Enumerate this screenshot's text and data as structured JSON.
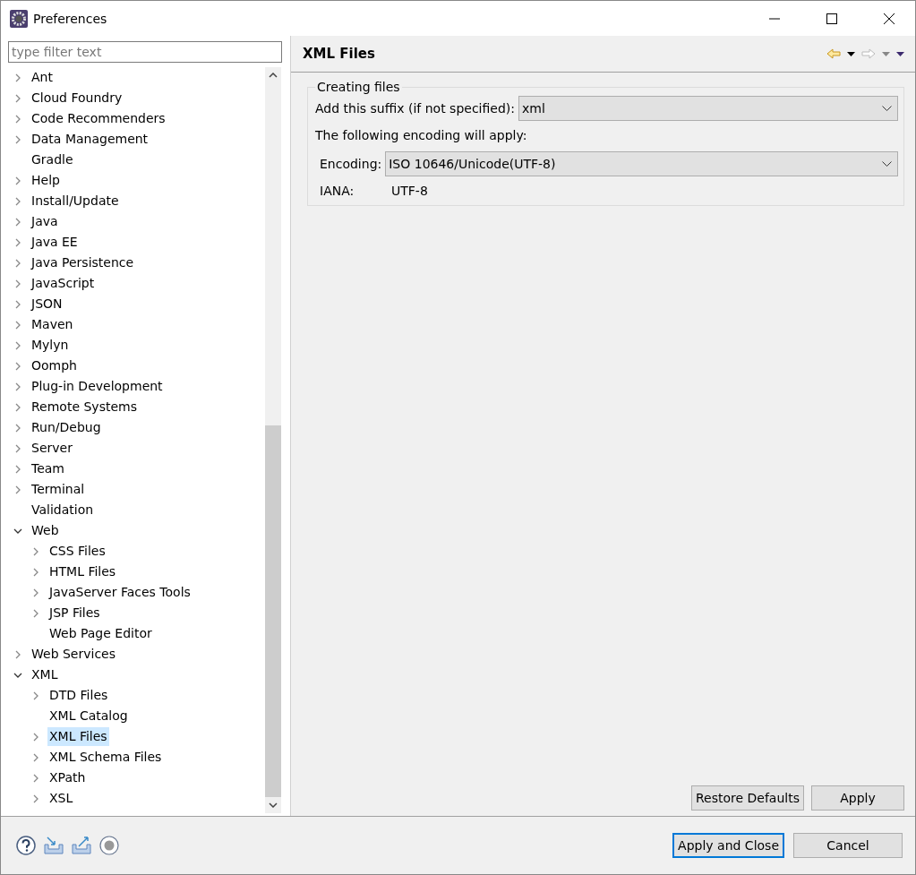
{
  "window": {
    "title": "Preferences"
  },
  "filter": {
    "placeholder": "type filter text"
  },
  "tree": [
    {
      "label": "Ant",
      "expandable": true,
      "expanded": false,
      "selected": false
    },
    {
      "label": "Cloud Foundry",
      "expandable": true,
      "expanded": false,
      "selected": false
    },
    {
      "label": "Code Recommenders",
      "expandable": true,
      "expanded": false,
      "selected": false
    },
    {
      "label": "Data Management",
      "expandable": true,
      "expanded": false,
      "selected": false
    },
    {
      "label": "Gradle",
      "expandable": false,
      "selected": false
    },
    {
      "label": "Help",
      "expandable": true,
      "expanded": false,
      "selected": false
    },
    {
      "label": "Install/Update",
      "expandable": true,
      "expanded": false,
      "selected": false
    },
    {
      "label": "Java",
      "expandable": true,
      "expanded": false,
      "selected": false
    },
    {
      "label": "Java EE",
      "expandable": true,
      "expanded": false,
      "selected": false
    },
    {
      "label": "Java Persistence",
      "expandable": true,
      "expanded": false,
      "selected": false
    },
    {
      "label": "JavaScript",
      "expandable": true,
      "expanded": false,
      "selected": false
    },
    {
      "label": "JSON",
      "expandable": true,
      "expanded": false,
      "selected": false
    },
    {
      "label": "Maven",
      "expandable": true,
      "expanded": false,
      "selected": false
    },
    {
      "label": "Mylyn",
      "expandable": true,
      "expanded": false,
      "selected": false
    },
    {
      "label": "Oomph",
      "expandable": true,
      "expanded": false,
      "selected": false
    },
    {
      "label": "Plug-in Development",
      "expandable": true,
      "expanded": false,
      "selected": false
    },
    {
      "label": "Remote Systems",
      "expandable": true,
      "expanded": false,
      "selected": false
    },
    {
      "label": "Run/Debug",
      "expandable": true,
      "expanded": false,
      "selected": false
    },
    {
      "label": "Server",
      "expandable": true,
      "expanded": false,
      "selected": false
    },
    {
      "label": "Team",
      "expandable": true,
      "expanded": false,
      "selected": false
    },
    {
      "label": "Terminal",
      "expandable": true,
      "expanded": false,
      "selected": false
    },
    {
      "label": "Validation",
      "expandable": false,
      "selected": false
    },
    {
      "label": "Web",
      "expandable": true,
      "expanded": true,
      "selected": false,
      "children": [
        {
          "label": "CSS Files",
          "expandable": true,
          "expanded": false,
          "selected": false
        },
        {
          "label": "HTML Files",
          "expandable": true,
          "expanded": false,
          "selected": false
        },
        {
          "label": "JavaServer Faces Tools",
          "expandable": true,
          "expanded": false,
          "selected": false
        },
        {
          "label": "JSP Files",
          "expandable": true,
          "expanded": false,
          "selected": false
        },
        {
          "label": "Web Page Editor",
          "expandable": false,
          "selected": false
        }
      ]
    },
    {
      "label": "Web Services",
      "expandable": true,
      "expanded": false,
      "selected": false
    },
    {
      "label": "XML",
      "expandable": true,
      "expanded": true,
      "selected": false,
      "children": [
        {
          "label": "DTD Files",
          "expandable": true,
          "expanded": false,
          "selected": false
        },
        {
          "label": "XML Catalog",
          "expandable": false,
          "selected": false
        },
        {
          "label": "XML Files",
          "expandable": true,
          "expanded": false,
          "selected": true
        },
        {
          "label": "XML Schema Files",
          "expandable": true,
          "expanded": false,
          "selected": false
        },
        {
          "label": "XPath",
          "expandable": true,
          "expanded": false,
          "selected": false
        },
        {
          "label": "XSL",
          "expandable": true,
          "expanded": false,
          "selected": false
        }
      ]
    }
  ],
  "page": {
    "title": "XML Files",
    "group": {
      "title": "Creating files",
      "suffix": {
        "label": "Add this suffix (if not specified):",
        "value": "xml"
      },
      "note": "The following encoding will apply:",
      "encoding": {
        "label": "Encoding:",
        "value": "ISO 10646/Unicode(UTF-8)"
      },
      "iana": {
        "label": "IANA:",
        "value": "UTF-8"
      }
    },
    "buttons": [
      {
        "label": "Restore Defaults",
        "default": false
      },
      {
        "label": "Apply",
        "default": false
      }
    ]
  },
  "footer_buttons": [
    {
      "label": "Apply and Close",
      "default": true
    },
    {
      "label": "Cancel",
      "default": false
    }
  ]
}
